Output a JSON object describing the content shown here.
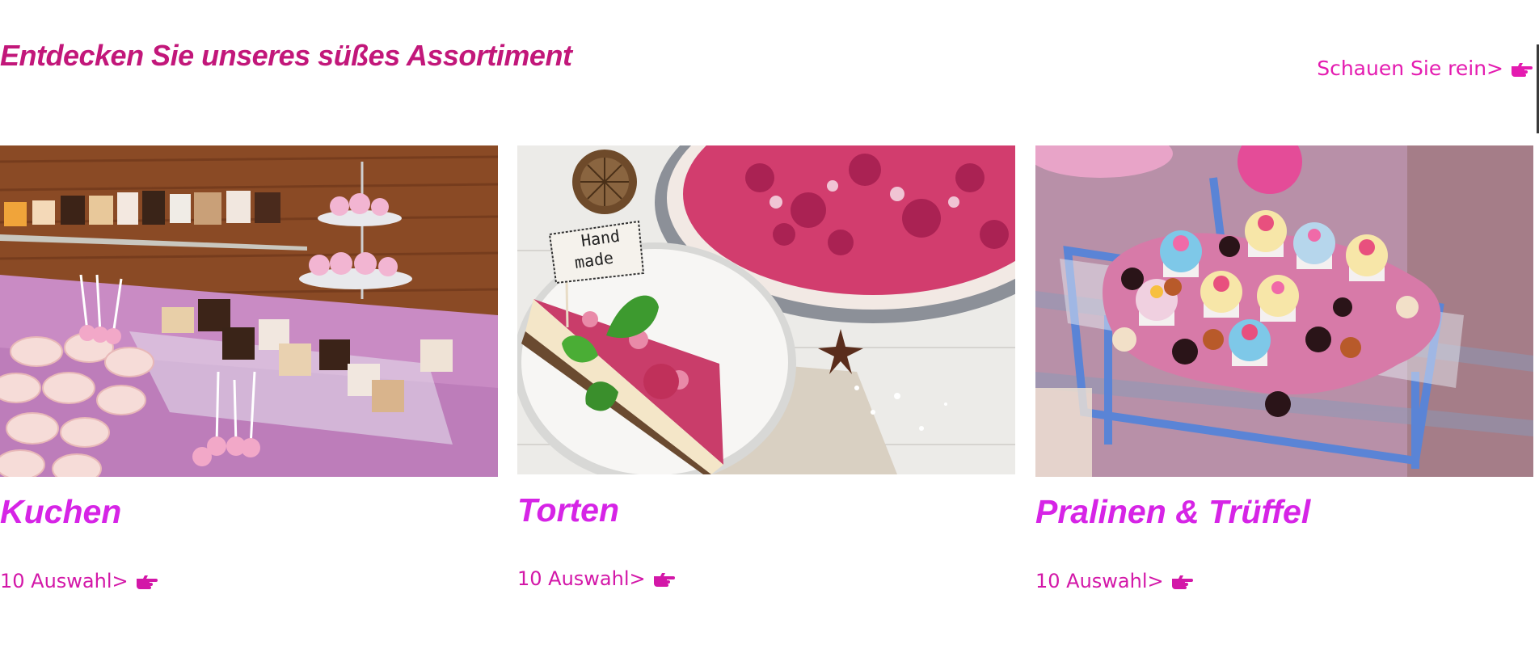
{
  "section": {
    "title": "Entdecken Sie unseres süßes Assortiment",
    "see_more_label": "Schauen Sie rein>",
    "see_more_icon": "hand-pointing-right-icon"
  },
  "colors": {
    "title": "#c2177a",
    "card_title": "#d624e6",
    "link": "#d317a8",
    "background": "#ffffff"
  },
  "cards": [
    {
      "title": "Kuchen",
      "link_label": "10 Auswahl>",
      "link_icon": "hand-pointing-right-icon",
      "image": "dessert-buffet-photo"
    },
    {
      "title": "Torten",
      "link_label": "10 Auswahl>",
      "link_icon": "hand-pointing-right-icon",
      "image": "raspberry-cheesecake-photo",
      "image_flag_text_line1": "Hand",
      "image_flag_text_line2": "made"
    },
    {
      "title": "Pralinen & Trüffel",
      "link_label": "10 Auswahl>",
      "link_icon": "hand-pointing-right-icon",
      "image": "cupcakes-truffles-photo"
    }
  ]
}
